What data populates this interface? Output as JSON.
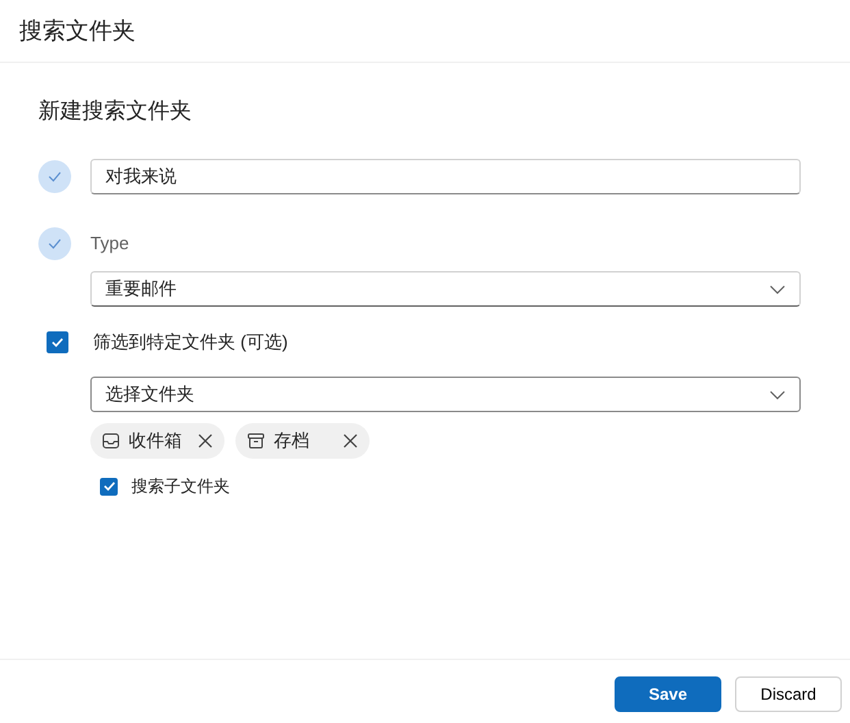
{
  "title": "搜索文件夹",
  "heading": "新建搜索文件夹",
  "name_step": {
    "completed": true,
    "value": "对我来说"
  },
  "type_step": {
    "completed": true,
    "label": "Type",
    "value": "重要邮件"
  },
  "folder_filter": {
    "checked": true,
    "label": "筛选到特定文件夹 (可选)"
  },
  "folder_select": {
    "placeholder": "选择文件夹"
  },
  "chips": [
    {
      "kind": "inbox",
      "label": "收件箱"
    },
    {
      "kind": "archive",
      "label": "存档"
    }
  ],
  "subfolders": {
    "checked": true,
    "label": "搜索子文件夹"
  },
  "buttons": [
    {
      "kind": "primary",
      "label": "Save"
    },
    {
      "kind": "secondary",
      "label": "Discard"
    }
  ]
}
